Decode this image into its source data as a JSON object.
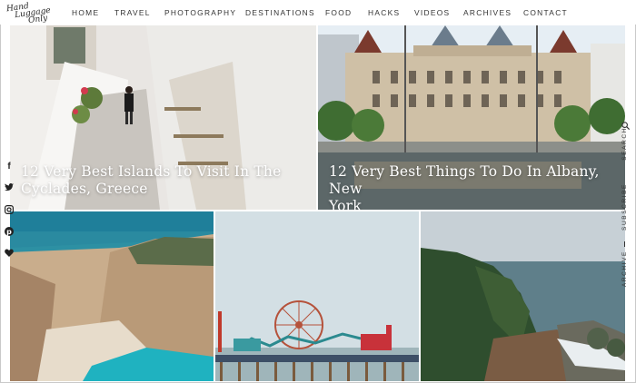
{
  "logo": {
    "line1": "Hand",
    "line2": "Luggage",
    "line3": "Only"
  },
  "nav": {
    "items": [
      "HOME",
      "TRAVEL",
      "PHOTOGRAPHY",
      "DESTINATIONS",
      "FOOD",
      "HACKS",
      "VIDEOS",
      "ARCHIVES",
      "CONTACT"
    ]
  },
  "posts": [
    {
      "title_line1": "12 Very Best Islands To Visit In The",
      "title_line2": "Cyclades, Greece"
    },
    {
      "title_line1": "12 Very Best Things To Do In Albany, New",
      "title_line2": "York"
    }
  ],
  "social": {
    "icons": [
      "facebook-icon",
      "twitter-icon",
      "instagram-icon",
      "pinterest-icon",
      "heart-icon"
    ]
  },
  "right_bar": {
    "search": "SEARCH",
    "subscribe": "SUBSCRIBE",
    "archive": "ARCHIVE"
  }
}
